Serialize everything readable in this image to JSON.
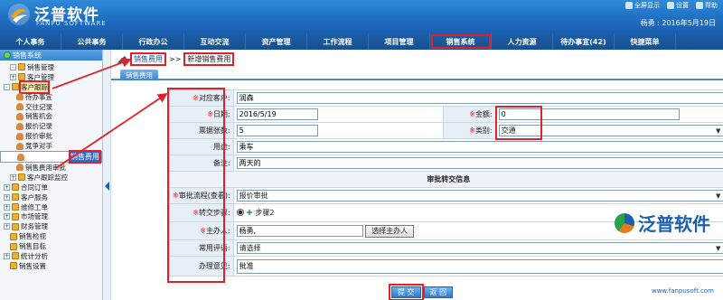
{
  "app": {
    "brand": "泛普软件",
    "brand_en": "FANPU SOFTWARE",
    "top_links": [
      "全屏显示",
      "设置",
      "帮助"
    ],
    "user_line": "杨勇 : 2016年5月19日"
  },
  "nav": {
    "items": [
      "个人事务",
      "公共事务",
      "行政办公",
      "互动交流",
      "资产管理",
      "工作流程",
      "项目管理",
      "销售系统",
      "人力资源",
      "待办事宜(42)",
      "快捷菜单"
    ],
    "active_index": 7
  },
  "sidebar": {
    "title": "销售系统",
    "items": [
      {
        "label": "销售管理",
        "indent": 1,
        "icon": "folder",
        "toggle": "-"
      },
      {
        "label": "客户管理",
        "indent": 1,
        "icon": "folder",
        "toggle": "+"
      },
      {
        "label": "客户跟踪",
        "indent": 0,
        "icon": "folder",
        "toggle": "-",
        "highlight": true
      },
      {
        "label": "待办事宜",
        "indent": 2,
        "icon": "person"
      },
      {
        "label": "交往记录",
        "indent": 2,
        "icon": "person"
      },
      {
        "label": "销售机会",
        "indent": 2,
        "icon": "person"
      },
      {
        "label": "报价记录",
        "indent": 2,
        "icon": "person"
      },
      {
        "label": "报价审批",
        "indent": 2,
        "icon": "person"
      },
      {
        "label": "竞争对手",
        "indent": 2,
        "icon": "person"
      },
      {
        "label": "销售费用",
        "indent": 2,
        "icon": "person",
        "selected": true
      },
      {
        "label": "销售费用审批",
        "indent": 2,
        "icon": "person"
      },
      {
        "label": "客户跟踪监控",
        "indent": 1,
        "icon": "folder",
        "toggle": "+"
      },
      {
        "label": "合同订单",
        "indent": 0,
        "icon": "folder",
        "toggle": "+"
      },
      {
        "label": "客户服务",
        "indent": 0,
        "icon": "folder",
        "toggle": "+"
      },
      {
        "label": "维修工单",
        "indent": 0,
        "icon": "folder",
        "toggle": "+"
      },
      {
        "label": "市场管理",
        "indent": 0,
        "icon": "folder",
        "toggle": "+"
      },
      {
        "label": "财务管理",
        "indent": 0,
        "icon": "folder",
        "toggle": "+"
      },
      {
        "label": "销售检视",
        "indent": 1,
        "icon": "folder"
      },
      {
        "label": "销售目标",
        "indent": 1,
        "icon": "folder"
      },
      {
        "label": "统计分析",
        "indent": 0,
        "icon": "folder",
        "toggle": "+"
      },
      {
        "label": "销售设置",
        "indent": 1,
        "icon": "folder"
      }
    ]
  },
  "breadcrumb": {
    "first": "销售费用",
    "sep": ">>",
    "second": "新增销售费用"
  },
  "tab": {
    "label": "销售费用"
  },
  "form": {
    "customer_label": "对应客户:",
    "customer_value": "润森",
    "date_label": "日期:",
    "date_value": "2016/5/19",
    "amount_label": "金额:",
    "amount_value": "0",
    "receipt_label": "票据张数:",
    "receipt_value": "5",
    "category_label": "类别:",
    "category_value": "交通",
    "purpose_label": "用途:",
    "purpose_value": "乘车",
    "remark_label": "备注:",
    "remark_value": "两天的",
    "section_title": "审批转交信息",
    "flow_label": "审批流程(查看):",
    "flow_value": "报价审批",
    "step_label": "转交步骤:",
    "step_value": "步骤2",
    "owner_label": "主办人:",
    "owner_value": "杨勇,",
    "owner_button": "选择主办人",
    "phrase_label": "常用评语:",
    "phrase_value": "请选择",
    "opinion_label": "办理意见:",
    "opinion_value": "批准"
  },
  "actions": {
    "submit": "提 交",
    "back": "返 回"
  },
  "watermark": {
    "text": "泛普软件",
    "url": "www.fanpusoft.com"
  },
  "colors": {
    "header": "#1f6fc3",
    "accent": "#e0202a",
    "label_bg": "#e6eef8"
  }
}
